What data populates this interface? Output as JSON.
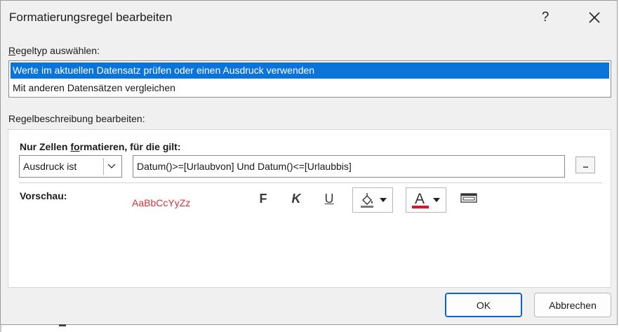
{
  "dialog": {
    "title": "Formatierungsregel bearbeiten",
    "help_label": "?",
    "close_icon": "close-icon"
  },
  "rule_type": {
    "label_prefix": "R",
    "label_rest": "egeltyp auswählen:",
    "items": [
      {
        "label": "Werte im aktuellen Datensatz prüfen oder einen Ausdruck verwenden",
        "selected": true
      },
      {
        "label": "Mit anderen Datensätzen vergleichen",
        "selected": false
      }
    ]
  },
  "rule_description": {
    "label": "Regelbeschreibung bearbeiten:",
    "condition_label_pre": "Nur Zellen ",
    "condition_label_ul": "fo",
    "condition_label_post": "rmatieren, für die gilt:",
    "condition_type": "Ausdruck ist",
    "expression": "Datum()>=[Urlaubvon] Und Datum()<=[Urlaubbis]",
    "dots_label": "...",
    "preview_label": "Vorschau:",
    "preview_sample": "AaBbCcYyZz",
    "bold_label": "F",
    "italic_label": "K",
    "underline_label": "U",
    "fill_color_icon": "fill-bucket-icon",
    "font_color_icon": "font-color-icon",
    "font_color_letter": "A",
    "enable_icon": "enable-toggle-icon"
  },
  "colors": {
    "selection": "#0a74da",
    "preview_text": "#d13438",
    "font_color_bar": "#e81123",
    "primary_border": "#0a64c4"
  },
  "buttons": {
    "ok": "OK",
    "cancel": "Abbrechen"
  }
}
